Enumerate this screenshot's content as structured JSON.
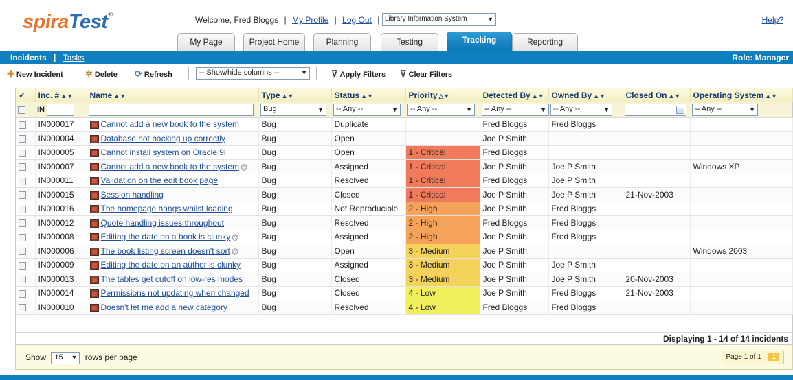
{
  "header": {
    "logo_part1": "spira",
    "logo_part2": "Test",
    "logo_reg": "®",
    "welcome": "Welcome, Fred Bloggs",
    "my_profile": "My Profile",
    "log_out": "Log Out",
    "project": "Library Information System",
    "help": "Help?"
  },
  "tabs": [
    "My Page",
    "Project Home",
    "Planning",
    "Testing",
    "Tracking",
    "Reporting"
  ],
  "active_tab": "Tracking",
  "subnav": {
    "incidents": "Incidents",
    "tasks": "Tasks",
    "role": "Role: Manager"
  },
  "toolbar": {
    "new_incident": "New Incident",
    "delete": "Delete",
    "refresh": "Refresh",
    "show_hide": "-- Show/hide columns --",
    "apply_filters": "Apply Filters",
    "clear_filters": "Clear Filters"
  },
  "columns": [
    "Inc. #",
    "Name",
    "Type",
    "Status",
    "Priority",
    "Detected By",
    "Owned By",
    "Closed On",
    "Operating System"
  ],
  "check_all": "✓",
  "filters": {
    "inc_prefix": "IN",
    "type": "Bug",
    "status": "-- Any --",
    "priority": "-- Any --",
    "detected": "-- Any --",
    "owned": "-- Any --",
    "os": "-- Any --"
  },
  "priority_colors": {
    "1 - Critical": "#f07a5a",
    "2 - High": "#f5a35a",
    "3 - Medium": "#f5d25a",
    "4 - Low": "#f1ef5c"
  },
  "rows": [
    {
      "id": "IN000017",
      "name": "Cannot add a new book to the system",
      "attach": false,
      "type": "Bug",
      "status": "Duplicate",
      "priority": "",
      "detected": "Fred Bloggs",
      "owned": "Fred Bloggs",
      "closed": "",
      "os": ""
    },
    {
      "id": "IN000004",
      "name": "Database not backing up correctly",
      "attach": false,
      "type": "Bug",
      "status": "Open",
      "priority": "",
      "detected": "Joe P Smith",
      "owned": "",
      "closed": "",
      "os": ""
    },
    {
      "id": "IN000005",
      "name": "Cannot install system on Oracle 9i",
      "attach": false,
      "type": "Bug",
      "status": "Open",
      "priority": "1 - Critical",
      "detected": "Fred Bloggs",
      "owned": "",
      "closed": "",
      "os": ""
    },
    {
      "id": "IN000007",
      "name": "Cannot add a new book to the system",
      "attach": true,
      "type": "Bug",
      "status": "Assigned",
      "priority": "1 - Critical",
      "detected": "Joe P Smith",
      "owned": "Joe P Smith",
      "closed": "",
      "os": "Windows XP"
    },
    {
      "id": "IN000011",
      "name": "Validation on the edit book page",
      "attach": false,
      "type": "Bug",
      "status": "Resolved",
      "priority": "1 - Critical",
      "detected": "Fred Bloggs",
      "owned": "Joe P Smith",
      "closed": "",
      "os": ""
    },
    {
      "id": "IN000015",
      "name": "Session handling",
      "attach": false,
      "type": "Bug",
      "status": "Closed",
      "priority": "1 - Critical",
      "detected": "Joe P Smith",
      "owned": "Joe P Smith",
      "closed": "21-Nov-2003",
      "os": ""
    },
    {
      "id": "IN000016",
      "name": "The homepage hangs whilst loading",
      "attach": false,
      "type": "Bug",
      "status": "Not Reproducible",
      "priority": "2 - High",
      "detected": "Joe P Smith",
      "owned": "Fred Bloggs",
      "closed": "",
      "os": ""
    },
    {
      "id": "IN000012",
      "name": "Quote handling issues throughout",
      "attach": false,
      "type": "Bug",
      "status": "Resolved",
      "priority": "2 - High",
      "detected": "Fred Bloggs",
      "owned": "Fred Bloggs",
      "closed": "",
      "os": ""
    },
    {
      "id": "IN000008",
      "name": "Editing the date on a book is clunky",
      "attach": true,
      "type": "Bug",
      "status": "Assigned",
      "priority": "2 - High",
      "detected": "Joe P Smith",
      "owned": "Fred Bloggs",
      "closed": "",
      "os": ""
    },
    {
      "id": "IN000006",
      "name": "The book listing screen doesn't sort",
      "attach": true,
      "type": "Bug",
      "status": "Open",
      "priority": "3 - Medium",
      "detected": "Joe P Smith",
      "owned": "",
      "closed": "",
      "os": "Windows 2003"
    },
    {
      "id": "IN000009",
      "name": "Editing the date on an author is clunky",
      "attach": false,
      "type": "Bug",
      "status": "Assigned",
      "priority": "3 - Medium",
      "detected": "Joe P Smith",
      "owned": "Joe P Smith",
      "closed": "",
      "os": ""
    },
    {
      "id": "IN000013",
      "name": "The tables get cutoff on low-res modes",
      "attach": false,
      "type": "Bug",
      "status": "Closed",
      "priority": "3 - Medium",
      "detected": "Joe P Smith",
      "owned": "Joe P Smith",
      "closed": "20-Nov-2003",
      "os": ""
    },
    {
      "id": "IN000014",
      "name": "Permissions not updating when changed",
      "attach": false,
      "type": "Bug",
      "status": "Closed",
      "priority": "4 - Low",
      "detected": "Joe P Smith",
      "owned": "Fred Bloggs",
      "closed": "21-Nov-2003",
      "os": ""
    },
    {
      "id": "IN000010",
      "name": "Doesn't let me add a new category",
      "attach": false,
      "type": "Bug",
      "status": "Resolved",
      "priority": "4 - Low",
      "detected": "Fred Bloggs",
      "owned": "Fred Bloggs",
      "closed": "",
      "os": ""
    }
  ],
  "footer": {
    "displaying": "Displaying 1 - 14 of 14 incidents"
  },
  "pager": {
    "show": "Show",
    "rows_value": "15",
    "rows_suffix": "rows per page",
    "page_of": "Page 1 of 1",
    "page_num": "1"
  }
}
